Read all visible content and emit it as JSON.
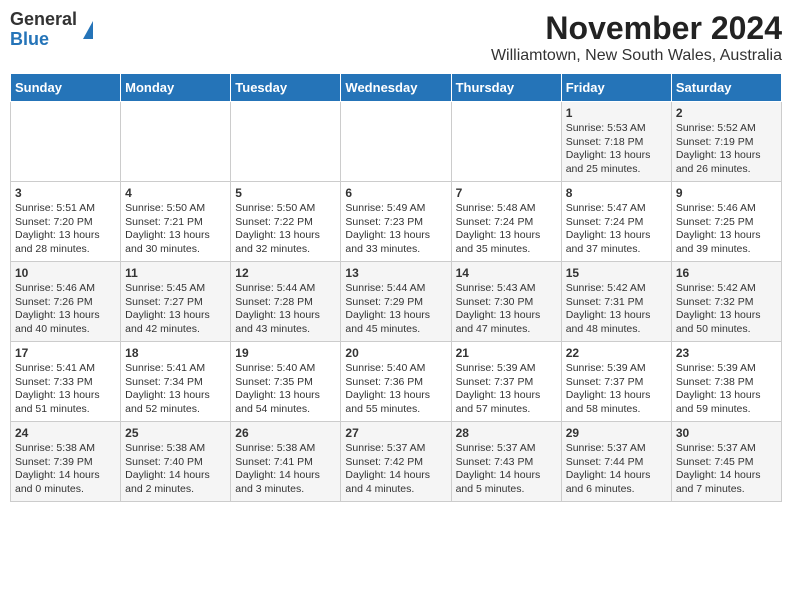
{
  "header": {
    "logo_general": "General",
    "logo_blue": "Blue",
    "title": "November 2024",
    "subtitle": "Williamtown, New South Wales, Australia"
  },
  "days_of_week": [
    "Sunday",
    "Monday",
    "Tuesday",
    "Wednesday",
    "Thursday",
    "Friday",
    "Saturday"
  ],
  "weeks": [
    [
      {
        "day": "",
        "info": ""
      },
      {
        "day": "",
        "info": ""
      },
      {
        "day": "",
        "info": ""
      },
      {
        "day": "",
        "info": ""
      },
      {
        "day": "",
        "info": ""
      },
      {
        "day": "1",
        "info": "Sunrise: 5:53 AM\nSunset: 7:18 PM\nDaylight: 13 hours\nand 25 minutes."
      },
      {
        "day": "2",
        "info": "Sunrise: 5:52 AM\nSunset: 7:19 PM\nDaylight: 13 hours\nand 26 minutes."
      }
    ],
    [
      {
        "day": "3",
        "info": "Sunrise: 5:51 AM\nSunset: 7:20 PM\nDaylight: 13 hours\nand 28 minutes."
      },
      {
        "day": "4",
        "info": "Sunrise: 5:50 AM\nSunset: 7:21 PM\nDaylight: 13 hours\nand 30 minutes."
      },
      {
        "day": "5",
        "info": "Sunrise: 5:50 AM\nSunset: 7:22 PM\nDaylight: 13 hours\nand 32 minutes."
      },
      {
        "day": "6",
        "info": "Sunrise: 5:49 AM\nSunset: 7:23 PM\nDaylight: 13 hours\nand 33 minutes."
      },
      {
        "day": "7",
        "info": "Sunrise: 5:48 AM\nSunset: 7:24 PM\nDaylight: 13 hours\nand 35 minutes."
      },
      {
        "day": "8",
        "info": "Sunrise: 5:47 AM\nSunset: 7:24 PM\nDaylight: 13 hours\nand 37 minutes."
      },
      {
        "day": "9",
        "info": "Sunrise: 5:46 AM\nSunset: 7:25 PM\nDaylight: 13 hours\nand 39 minutes."
      }
    ],
    [
      {
        "day": "10",
        "info": "Sunrise: 5:46 AM\nSunset: 7:26 PM\nDaylight: 13 hours\nand 40 minutes."
      },
      {
        "day": "11",
        "info": "Sunrise: 5:45 AM\nSunset: 7:27 PM\nDaylight: 13 hours\nand 42 minutes."
      },
      {
        "day": "12",
        "info": "Sunrise: 5:44 AM\nSunset: 7:28 PM\nDaylight: 13 hours\nand 43 minutes."
      },
      {
        "day": "13",
        "info": "Sunrise: 5:44 AM\nSunset: 7:29 PM\nDaylight: 13 hours\nand 45 minutes."
      },
      {
        "day": "14",
        "info": "Sunrise: 5:43 AM\nSunset: 7:30 PM\nDaylight: 13 hours\nand 47 minutes."
      },
      {
        "day": "15",
        "info": "Sunrise: 5:42 AM\nSunset: 7:31 PM\nDaylight: 13 hours\nand 48 minutes."
      },
      {
        "day": "16",
        "info": "Sunrise: 5:42 AM\nSunset: 7:32 PM\nDaylight: 13 hours\nand 50 minutes."
      }
    ],
    [
      {
        "day": "17",
        "info": "Sunrise: 5:41 AM\nSunset: 7:33 PM\nDaylight: 13 hours\nand 51 minutes."
      },
      {
        "day": "18",
        "info": "Sunrise: 5:41 AM\nSunset: 7:34 PM\nDaylight: 13 hours\nand 52 minutes."
      },
      {
        "day": "19",
        "info": "Sunrise: 5:40 AM\nSunset: 7:35 PM\nDaylight: 13 hours\nand 54 minutes."
      },
      {
        "day": "20",
        "info": "Sunrise: 5:40 AM\nSunset: 7:36 PM\nDaylight: 13 hours\nand 55 minutes."
      },
      {
        "day": "21",
        "info": "Sunrise: 5:39 AM\nSunset: 7:37 PM\nDaylight: 13 hours\nand 57 minutes."
      },
      {
        "day": "22",
        "info": "Sunrise: 5:39 AM\nSunset: 7:37 PM\nDaylight: 13 hours\nand 58 minutes."
      },
      {
        "day": "23",
        "info": "Sunrise: 5:39 AM\nSunset: 7:38 PM\nDaylight: 13 hours\nand 59 minutes."
      }
    ],
    [
      {
        "day": "24",
        "info": "Sunrise: 5:38 AM\nSunset: 7:39 PM\nDaylight: 14 hours\nand 0 minutes."
      },
      {
        "day": "25",
        "info": "Sunrise: 5:38 AM\nSunset: 7:40 PM\nDaylight: 14 hours\nand 2 minutes."
      },
      {
        "day": "26",
        "info": "Sunrise: 5:38 AM\nSunset: 7:41 PM\nDaylight: 14 hours\nand 3 minutes."
      },
      {
        "day": "27",
        "info": "Sunrise: 5:37 AM\nSunset: 7:42 PM\nDaylight: 14 hours\nand 4 minutes."
      },
      {
        "day": "28",
        "info": "Sunrise: 5:37 AM\nSunset: 7:43 PM\nDaylight: 14 hours\nand 5 minutes."
      },
      {
        "day": "29",
        "info": "Sunrise: 5:37 AM\nSunset: 7:44 PM\nDaylight: 14 hours\nand 6 minutes."
      },
      {
        "day": "30",
        "info": "Sunrise: 5:37 AM\nSunset: 7:45 PM\nDaylight: 14 hours\nand 7 minutes."
      }
    ]
  ]
}
